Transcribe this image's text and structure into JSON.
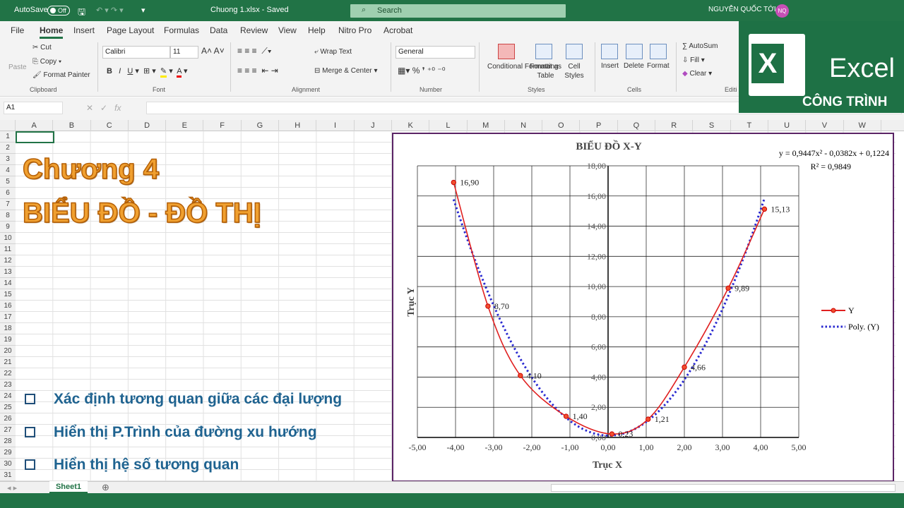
{
  "titlebar": {
    "autosave": "AutoSave",
    "toggle": "Off",
    "filename": "Chuong 1.xlsx  -  Saved",
    "search": "Search",
    "user": "NGUYỄN QUỐC TỚI",
    "initials": "NQ"
  },
  "tabs": [
    "File",
    "Home",
    "Insert",
    "Page Layout",
    "Formulas",
    "Data",
    "Review",
    "View",
    "Help",
    "Nitro Pro",
    "Acrobat"
  ],
  "ribbon": {
    "paste": "Paste",
    "cut": "Cut",
    "copy": "Copy",
    "format_painter": "Format Painter",
    "clipboard": "Clipboard",
    "font_name": "Calibri",
    "font_size": "11",
    "font": "Font",
    "wrap": "Wrap Text",
    "merge": "Merge & Center",
    "alignment": "Alignment",
    "number_format": "General",
    "number": "Number",
    "cond": "Conditional Formatting",
    "fmt_table": "Format as Table",
    "cell_styles": "Cell Styles",
    "styles": "Styles",
    "insert": "Insert",
    "delete": "Delete",
    "format": "Format",
    "cells": "Cells",
    "autosum": "AutoSum",
    "fill": "Fill",
    "clear": "Clear",
    "editing": "Editi"
  },
  "formula_bar": {
    "name_box": "A1",
    "value": ""
  },
  "columns": [
    "A",
    "B",
    "C",
    "D",
    "E",
    "F",
    "G",
    "H",
    "I",
    "J",
    "K",
    "L",
    "M",
    "N",
    "O",
    "P",
    "Q",
    "R",
    "S",
    "T",
    "U",
    "V",
    "W"
  ],
  "sheet_text": {
    "line1": "Chương 4",
    "line2": "BIỂU ĐỒ - ĐỒ THỊ",
    "bullets": [
      "Xác định tương quan giữa các đại lượng",
      "Hiển thị P.Trình của đường xu hướng",
      "Hiển thị hệ số tương quan"
    ]
  },
  "sheet_tab": "Sheet1",
  "logo": {
    "text": "Excel",
    "sub": "CÔNG TRÌNH"
  },
  "colors": {
    "excel_green": "#217346",
    "series": "#e02020",
    "trend": "#2a2ad0",
    "chart_border": "#5b2466"
  },
  "chart_data": {
    "type": "scatter",
    "title": "BIỂU ĐỒ X-Y",
    "xlabel": "Trục X",
    "ylabel": "Trục Y",
    "xlim": [
      -5,
      5
    ],
    "ylim": [
      0,
      18
    ],
    "xstep": 1,
    "ystep": 2,
    "grid": true,
    "legend": "right",
    "series": [
      {
        "name": "Y",
        "x": [
          -4.05,
          -3.15,
          -2.3,
          -1.1,
          0.1,
          1.05,
          2.0,
          3.15,
          4.1
        ],
        "y": [
          16.9,
          8.7,
          4.1,
          1.4,
          0.23,
          1.21,
          4.66,
          9.89,
          15.13
        ],
        "labels": [
          "16,90",
          "8,70",
          "4,10",
          "1,40",
          "0,23",
          "1,21",
          "4,66",
          "9,89",
          "15,13"
        ]
      }
    ],
    "trendline": {
      "name": "Poly. (Y)",
      "coefficients": [
        0.9447,
        -0.0382,
        0.1224
      ],
      "equation": "y = 0,9447x² - 0,0382x + 0,1224",
      "r2": "R² = 0,9849"
    }
  }
}
